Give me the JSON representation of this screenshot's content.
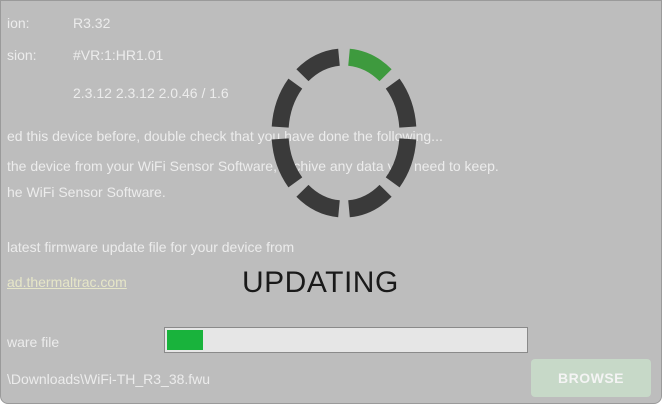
{
  "info": {
    "version_label": "ion:",
    "version_value": "R3.32",
    "revision_label": "sion:",
    "revision_value": "#VR:1:HR1.01",
    "components_value": "2.3.12 2.3.12 2.0.46 / 1.6"
  },
  "instructions": {
    "line1": "ed this device before, double check that you have done the following...",
    "line2": "the device from your WiFi Sensor Software, archive any data you need to keep.",
    "line3": "he WiFi Sensor Software.",
    "line4": "latest firmware update file for your device from",
    "link": "ad.thermaltrac.com"
  },
  "overlay": {
    "status_text": "UPDATING",
    "spinner_active_segment": 0,
    "spinner_active_color": "#3e9a3e",
    "spinner_color": "#3a3a3a"
  },
  "firmware": {
    "label": "ware file",
    "path": "\\Downloads\\WiFi-TH_R3_38.fwu",
    "progress_fraction": 0.1,
    "browse_label": "BROWSE"
  }
}
